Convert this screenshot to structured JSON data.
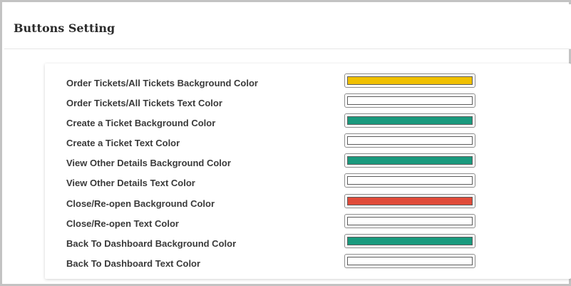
{
  "panel": {
    "title": "Buttons Setting"
  },
  "settings": [
    {
      "label": "Order Tickets/All Tickets Background Color",
      "color": "#f0c000"
    },
    {
      "label": "Order Tickets/All Tickets Text Color",
      "color": "#ffffff"
    },
    {
      "label": "Create a Ticket Background Color",
      "color": "#1a9a7e"
    },
    {
      "label": "Create a Ticket Text Color",
      "color": "#ffffff"
    },
    {
      "label": "View Other Details Background Color",
      "color": "#1a9a7e"
    },
    {
      "label": "View Other Details Text Color",
      "color": "#ffffff"
    },
    {
      "label": "Close/Re-open Background Color",
      "color": "#e04b3a"
    },
    {
      "label": "Close/Re-open Text Color",
      "color": "#ffffff"
    },
    {
      "label": "Back To Dashboard Background Color",
      "color": "#1a9a7e"
    },
    {
      "label": "Back To Dashboard Text Color",
      "color": "#ffffff"
    }
  ]
}
